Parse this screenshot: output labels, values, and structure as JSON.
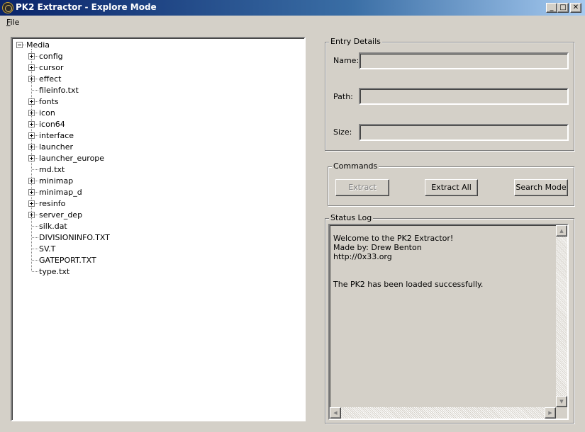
{
  "window": {
    "title": "PK2 Extractor - Explore Mode",
    "min_glyph": "_",
    "max_glyph": "□",
    "close_glyph": "✕"
  },
  "menu": {
    "file": "File"
  },
  "tree": {
    "root": "Media",
    "items": [
      {
        "label": "config",
        "expandable": true
      },
      {
        "label": "cursor",
        "expandable": true
      },
      {
        "label": "effect",
        "expandable": true
      },
      {
        "label": "fileinfo.txt",
        "expandable": false
      },
      {
        "label": "fonts",
        "expandable": true
      },
      {
        "label": "icon",
        "expandable": true
      },
      {
        "label": "icon64",
        "expandable": true
      },
      {
        "label": "interface",
        "expandable": true
      },
      {
        "label": "launcher",
        "expandable": true
      },
      {
        "label": "launcher_europe",
        "expandable": true
      },
      {
        "label": "md.txt",
        "expandable": false
      },
      {
        "label": "minimap",
        "expandable": true
      },
      {
        "label": "minimap_d",
        "expandable": true
      },
      {
        "label": "resinfo",
        "expandable": true
      },
      {
        "label": "server_dep",
        "expandable": true
      },
      {
        "label": "silk.dat",
        "expandable": false
      },
      {
        "label": "DIVISIONINFO.TXT",
        "expandable": false
      },
      {
        "label": "SV.T",
        "expandable": false
      },
      {
        "label": "GATEPORT.TXT",
        "expandable": false
      },
      {
        "label": "type.txt",
        "expandable": false
      }
    ]
  },
  "entry_details": {
    "title": "Entry Details",
    "name_label": "Name:",
    "name_value": "",
    "path_label": "Path:",
    "path_value": "",
    "size_label": "Size:",
    "size_value": ""
  },
  "commands": {
    "title": "Commands",
    "extract_label": "Extract",
    "extract_all_label": "Extract All",
    "search_mode_label": "Search Mode"
  },
  "status_log": {
    "title": "Status Log",
    "lines": [
      "Welcome to the PK2 Extractor!",
      "Made by: Drew Benton",
      "http://0x33.org",
      "",
      "",
      "The PK2 has been loaded successfully."
    ]
  },
  "icons": {
    "app": "pk2-app-icon",
    "scroll_up": "▲",
    "scroll_down": "▼",
    "scroll_left": "◀",
    "scroll_right": "▶"
  }
}
